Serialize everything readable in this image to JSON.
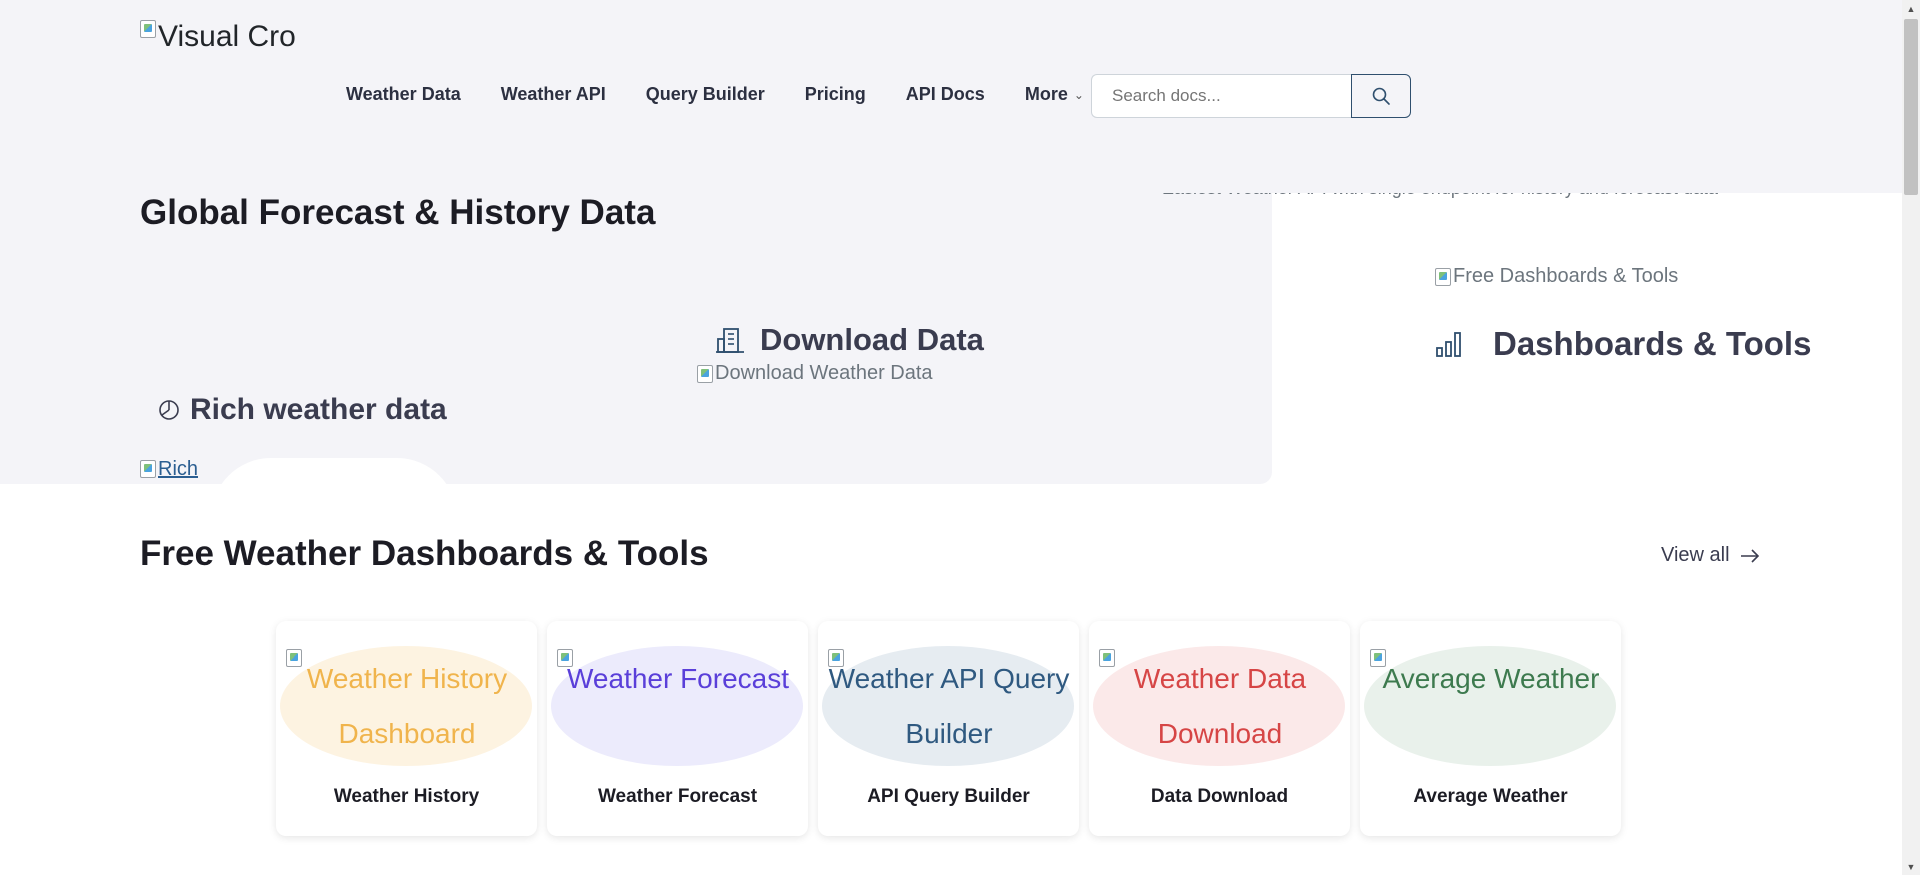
{
  "header": {
    "logo_alt": "Visual Crossing",
    "nav": [
      "Weather Data",
      "Weather API",
      "Query Builder",
      "Pricing",
      "API Docs"
    ],
    "more_label": "More",
    "search_placeholder": "Search docs...",
    "tagline": "Easiest Weather API with single endpoint for history and forecast data"
  },
  "hero": {
    "title": "Global Forecast & History Data",
    "download_title": "Download Data",
    "download_img_alt": "Download Weather Data",
    "rich_title": "Rich weather data",
    "rich_img_alt": "Rich",
    "dash_img_alt": "Free Dashboards & Tools",
    "dash_title": "Dashboards & Tools"
  },
  "tools": {
    "title": "Free Weather Dashboards & Tools",
    "view_all": "View all",
    "cards": [
      {
        "img_alt": "Weather History Dashboard",
        "label": "Weather History",
        "color": "#f0b44c",
        "bg": "#fdf3e1"
      },
      {
        "img_alt": "Weather Forecast",
        "label": "Weather Forecast",
        "color": "#5a3fd9",
        "bg": "#ecebfc"
      },
      {
        "img_alt": "Weather API Query Builder",
        "label": "API Query Builder",
        "color": "#2f5980",
        "bg": "#e6ecf1"
      },
      {
        "img_alt": "Weather Data Download",
        "label": "Data Download",
        "color": "#d64545",
        "bg": "#fbe9e9"
      },
      {
        "img_alt": "Average Weather",
        "label": "Average Weather",
        "color": "#3d7a4e",
        "bg": "#e9f1eb"
      }
    ]
  }
}
